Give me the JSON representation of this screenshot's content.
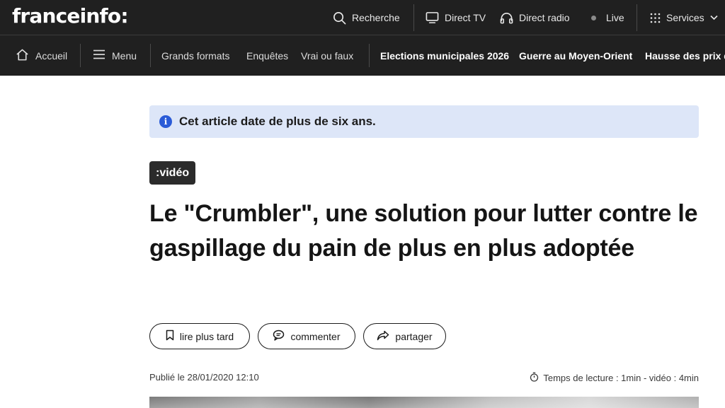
{
  "header": {
    "logo": "franceinfo:",
    "search_label": "Recherche",
    "direct_tv_label": "Direct TV",
    "direct_radio_label": "Direct radio",
    "live_label": "Live",
    "services_label": "Services"
  },
  "nav": {
    "home_label": "Accueil",
    "menu_label": "Menu",
    "links": [
      "Grands formats",
      "Enquêtes",
      "Vrai ou faux"
    ],
    "topics": [
      "Elections municipales 2026",
      "Guerre au Moyen-Orient",
      "Hausse des prix d"
    ]
  },
  "article": {
    "notice": "Cet article date de plus de six ans.",
    "tag": ":vidéo",
    "title": "Le \"Crumbler\", une solution pour lutter contre le gaspillage du pain de plus en plus adoptée",
    "actions": {
      "read_later": "lire plus tard",
      "comment": "commenter",
      "share": "partager"
    },
    "published": "Publié le 28/01/2020 12:10",
    "reading_time": "Temps de lecture : 1min - vidéo : 4min"
  },
  "colors": {
    "header_bg": "#202020",
    "notice_bg": "#dde6f8",
    "info_icon": "#2a5bd7",
    "tag_bg": "#2b2b2b"
  },
  "icons": [
    "search-icon",
    "tv-icon",
    "headphones-icon",
    "live-dot-icon",
    "grid-icon",
    "chevron-down-icon",
    "home-icon",
    "menu-icon",
    "info-icon",
    "bookmark-icon",
    "comment-icon",
    "share-icon",
    "timer-icon"
  ]
}
